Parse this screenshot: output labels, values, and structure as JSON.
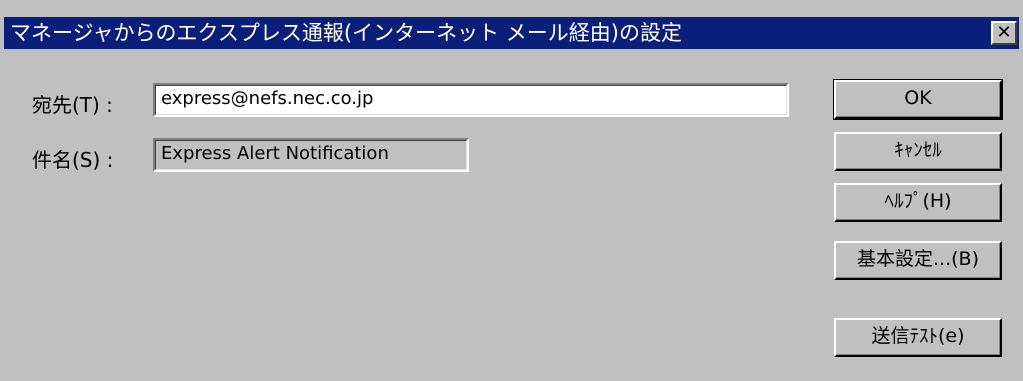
{
  "dialog": {
    "title": "マネージャからのエクスプレス通報(インターネット メール経由)の設定",
    "close_glyph": "✕"
  },
  "fields": {
    "to": {
      "label": "宛先(T) :",
      "value": "express@nefs.nec.co.jp"
    },
    "subject": {
      "label": "件名(S) :",
      "value": "Express Alert Notification"
    }
  },
  "buttons": {
    "ok": "OK",
    "cancel": "ｷｬﾝｾﾙ",
    "help": "ﾍﾙﾌﾟ(H)",
    "basic_settings": "基本設定...(B)",
    "send_test": "送信ﾃｽﾄ(e)"
  },
  "colors": {
    "titlebar": "#0a1f7a",
    "face": "#c0c0c0"
  }
}
